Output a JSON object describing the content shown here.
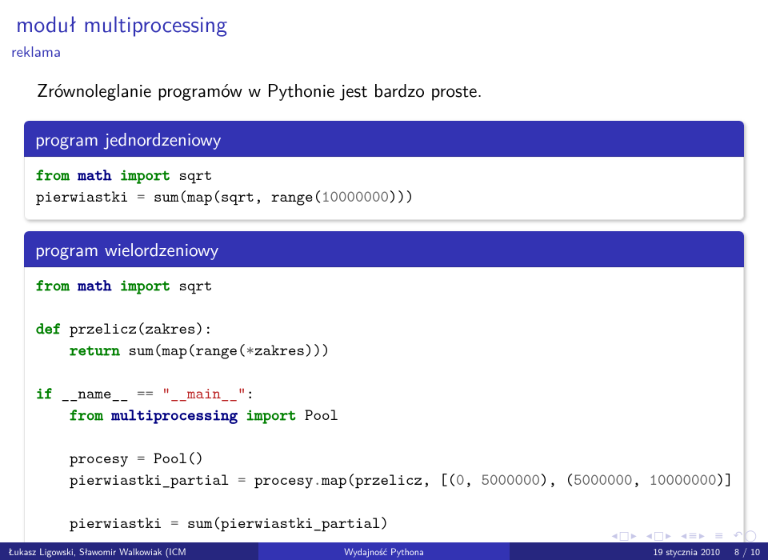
{
  "title": "moduł multiprocessing",
  "subtitle": "reklama",
  "intro": "Zrównoleglanie programów w Pythonie jest bardzo proste.",
  "block1": {
    "title": "program jednordzeniowy",
    "code": {
      "l1_from": "from",
      "l1_mod": "math",
      "l1_import": "import",
      "l1_name": "sqrt",
      "l2_lhs": "pierwiastki ",
      "l2_eq": "=",
      "l2_sum": " sum(map(sqrt, range(",
      "l2_num": "10000000",
      "l2_tail": ")))"
    }
  },
  "block2": {
    "title": "program wielordzeniowy",
    "code": {
      "l1_from": "from",
      "l1_mod": "math",
      "l1_import": "import",
      "l1_name": "sqrt",
      "l3_def": "def",
      "l3_fn": "przelicz",
      "l3_paren": "(zakres):",
      "l4_ret": "return",
      "l4_body": " sum(map(range(",
      "l4_star": "*",
      "l4_tail": "zakres)))",
      "l6_if": "if",
      "l6_name": " __name__ ",
      "l6_eq": "==",
      "l6_str": " \"__main__\"",
      "l6_colon": ":",
      "l7_from": "from",
      "l7_mod": "multiprocessing",
      "l7_import": "import",
      "l7_name": "Pool",
      "l9_a": "procesy ",
      "l9_eq": "=",
      "l9_b": " Pool()",
      "l10_a": "pierwiastki_partial ",
      "l10_eq": "=",
      "l10_b": " procesy",
      "l10_dot": ".",
      "l10_c": "map(przelicz, [(",
      "l10_n1": "0",
      "l10_m1": ", ",
      "l10_n2": "5000000",
      "l10_m2": "), (",
      "l10_n3": "5000000",
      "l10_m3": ", ",
      "l10_n4": "10000000",
      "l10_m4": ")]",
      "l12_a": "pierwiastki ",
      "l12_eq": "=",
      "l12_b": " sum(pierwiastki_partial)"
    }
  },
  "footer": {
    "author": "Łukasz Ligowski, Sławomir Walkowiak (ICM",
    "title": "Wydajność Pythona",
    "date": "19 stycznia 2010",
    "page": "8 / 10"
  },
  "nav": {
    "left": "◂",
    "right": "▸",
    "box": "□",
    "bar": "≡",
    "undo": "↶",
    "circ": "◯"
  }
}
